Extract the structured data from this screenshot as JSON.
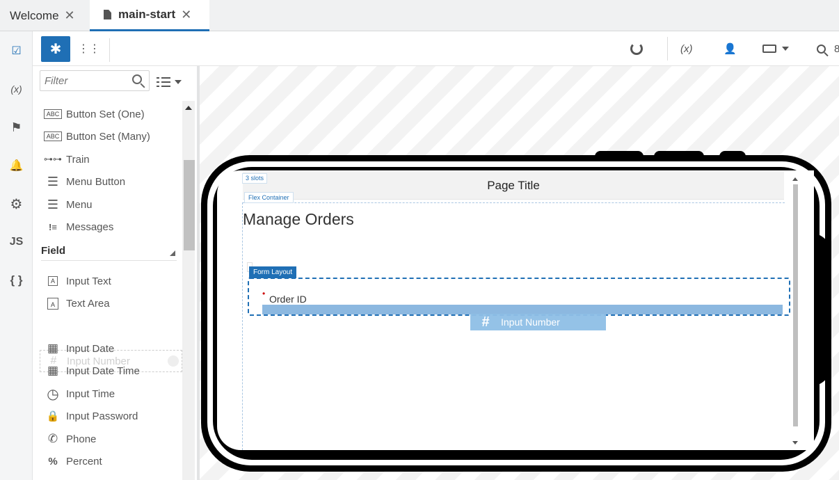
{
  "tabs": [
    {
      "label": "Welcome",
      "close": "✕"
    },
    {
      "label": "main-start",
      "close": "✕"
    }
  ],
  "activity_bar": [
    {
      "icon": "page-designer-icon",
      "glyph": "☑"
    },
    {
      "icon": "variables-icon",
      "glyph": "(x)"
    },
    {
      "icon": "flag-icon",
      "glyph": "⚑"
    },
    {
      "icon": "bell-icon",
      "glyph": "🔔"
    },
    {
      "icon": "gear-icon",
      "glyph": "⚙"
    },
    {
      "icon": "javascript-icon",
      "glyph": "JS"
    },
    {
      "icon": "json-icon",
      "glyph": "{ }"
    }
  ],
  "palette": {
    "components_glyph": "✱",
    "structure_glyph": "⋮⋮",
    "filter_placeholder": "Filter",
    "items_top": [
      {
        "label": "Button Set (One)",
        "icon": "abc-icon",
        "glyph": "ABC"
      },
      {
        "label": "Button Set (Many)",
        "icon": "abc-icon",
        "glyph": "ABC"
      },
      {
        "label": "Train",
        "icon": "train-icon",
        "glyph": "⊶⊶"
      },
      {
        "label": "Menu Button",
        "icon": "menu-button-icon",
        "glyph": "☰"
      },
      {
        "label": "Menu",
        "icon": "menu-icon",
        "glyph": "☰"
      },
      {
        "label": "Messages",
        "icon": "messages-icon",
        "glyph": "!≡"
      }
    ],
    "section": "Field",
    "items_field": [
      {
        "label": "Input Text",
        "icon": "input-text-icon",
        "glyph": "A"
      },
      {
        "label": "Text Area",
        "icon": "text-area-icon",
        "glyph": "A"
      },
      {
        "label": "Input Number",
        "icon": "hash-icon",
        "glyph": "#"
      },
      {
        "label": "Input Date",
        "icon": "calendar-icon",
        "glyph": "▦"
      },
      {
        "label": "Input Date Time",
        "icon": "calendar-clock-icon",
        "glyph": "▦"
      },
      {
        "label": "Input Time",
        "icon": "clock-icon",
        "glyph": "◷"
      },
      {
        "label": "Input Password",
        "icon": "lock-icon",
        "glyph": "🔒"
      },
      {
        "label": "Phone",
        "icon": "phone-icon",
        "glyph": "✆"
      },
      {
        "label": "Percent",
        "icon": "percent-icon",
        "glyph": "%"
      }
    ]
  },
  "designer_toolbar": {
    "refresh_icon": "refresh-icon",
    "variables_glyph": "(x)",
    "roles_glyph": "👤",
    "zoom_glyph": "8"
  },
  "canvas": {
    "slots_label": "3 slots",
    "page_title": "Page Title",
    "flex_container_label": "Flex Container",
    "heading": "Manage Orders",
    "form_layout_label": "Form Layout",
    "field_label": "Order ID",
    "required_mark": "•",
    "drag_ghost_label": "Input Number",
    "drag_ghost_glyph": "#"
  },
  "colors": {
    "accent": "#1f6fb5",
    "drop_indicator": "#8cb8e0"
  }
}
